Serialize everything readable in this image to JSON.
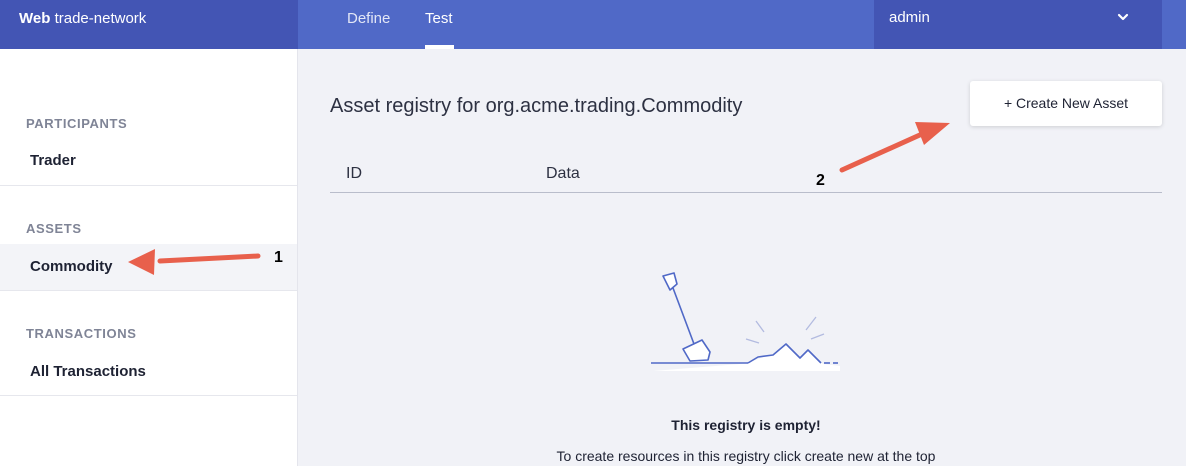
{
  "header": {
    "brand_bold": "Web",
    "brand_name": " trade-network",
    "tabs": [
      {
        "label": "Define"
      },
      {
        "label": "Test"
      }
    ],
    "user": "admin"
  },
  "sidebar": {
    "participants_heading": "PARTICIPANTS",
    "participants": [
      {
        "label": "Trader"
      }
    ],
    "assets_heading": "ASSETS",
    "assets": [
      {
        "label": "Commodity"
      }
    ],
    "transactions_heading": "TRANSACTIONS",
    "transactions": [
      {
        "label": "All Transactions"
      }
    ]
  },
  "main": {
    "title": "Asset registry for org.acme.trading.Commodity",
    "create_button": "+ Create New Asset",
    "columns": [
      "ID",
      "Data"
    ],
    "empty_title": "This registry is empty!",
    "empty_subtitle": "To create resources in this registry click create new at the top"
  },
  "annotations": [
    {
      "number": "1"
    },
    {
      "number": "2"
    }
  ],
  "colors": {
    "topbar": "#5069c7",
    "topbar_dark": "#4355b4",
    "arrow": "#e8604c",
    "background": "#f1f2f7",
    "illustration": "#5069c7"
  },
  "icons": {
    "user_dropdown": "chevron-down-icon",
    "empty_state": "shovel-illustration"
  }
}
